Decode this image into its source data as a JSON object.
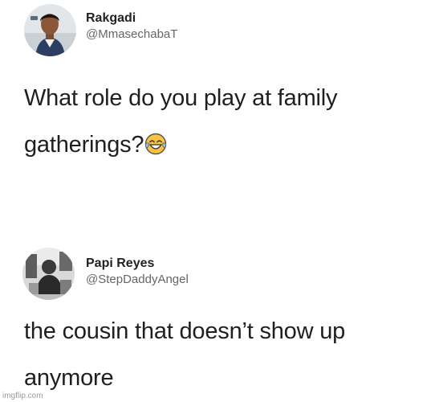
{
  "tweets": [
    {
      "display_name": "Rakgadi",
      "handle": "@MmasechabaT",
      "text": "What role do you play at family gatherings?",
      "emoji": "face-with-tears-of-joy"
    },
    {
      "display_name": "Papi Reyes",
      "handle": "@StepDaddyAngel",
      "text": "the cousin that doesn’t show up anymore"
    }
  ],
  "watermark": "imgflip.com"
}
